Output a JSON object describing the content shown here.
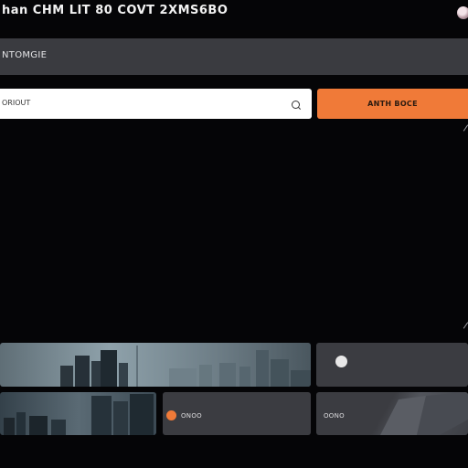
{
  "header": {
    "title": "han CHM LIT 80 COVT 2XMS6BO"
  },
  "section": {
    "label": "NTOMGIE"
  },
  "search": {
    "placeholder": "ORIOUT"
  },
  "action": {
    "label": "ANTH BOCE"
  },
  "cards": [
    {
      "label": ""
    },
    {
      "label": ""
    },
    {
      "label": "ONOO"
    },
    {
      "label": ""
    },
    {
      "label": "OONO"
    }
  ],
  "colors": {
    "accent": "#f07a38",
    "background": "#050507",
    "bar": "#3a3b40",
    "card": "#3b3c41"
  }
}
